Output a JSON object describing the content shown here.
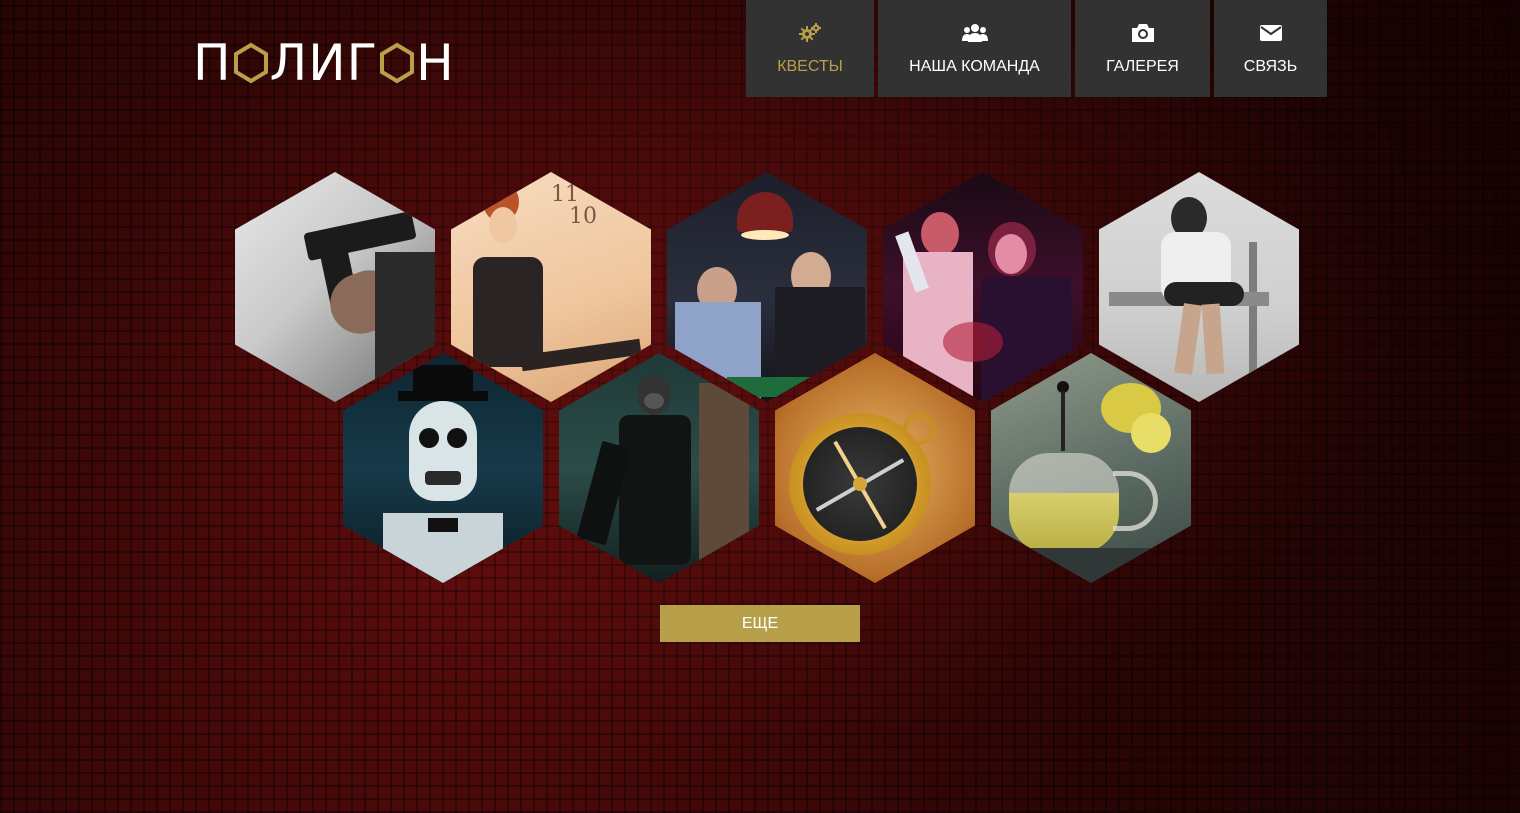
{
  "logo": {
    "text_part1": "П",
    "text_part2": "ЛИГ",
    "text_part3": "Н"
  },
  "nav": [
    {
      "label": "КВЕСТЫ",
      "icon": "gears-icon",
      "active": true
    },
    {
      "label": "НАША КОМАНДА",
      "icon": "users-icon",
      "active": false
    },
    {
      "label": "ГАЛЕРЕЯ",
      "icon": "camera-icon",
      "active": false
    },
    {
      "label": "СВЯЗЬ",
      "icon": "envelope-icon",
      "active": false
    }
  ],
  "quests": [
    {
      "image": "gun-photo"
    },
    {
      "image": "woman-clock-photo"
    },
    {
      "image": "men-cards-photo"
    },
    {
      "image": "horror-couple-photo"
    },
    {
      "image": "straitjacket-photo"
    },
    {
      "image": "skull-mask-photo"
    },
    {
      "image": "gasmask-photo"
    },
    {
      "image": "compass-photo"
    },
    {
      "image": "teapot-photo"
    }
  ],
  "more_button": {
    "label": "ЕЩЕ"
  },
  "colors": {
    "accent": "#b8a04a",
    "nav_bg": "#323232",
    "background": "#2a0606"
  }
}
